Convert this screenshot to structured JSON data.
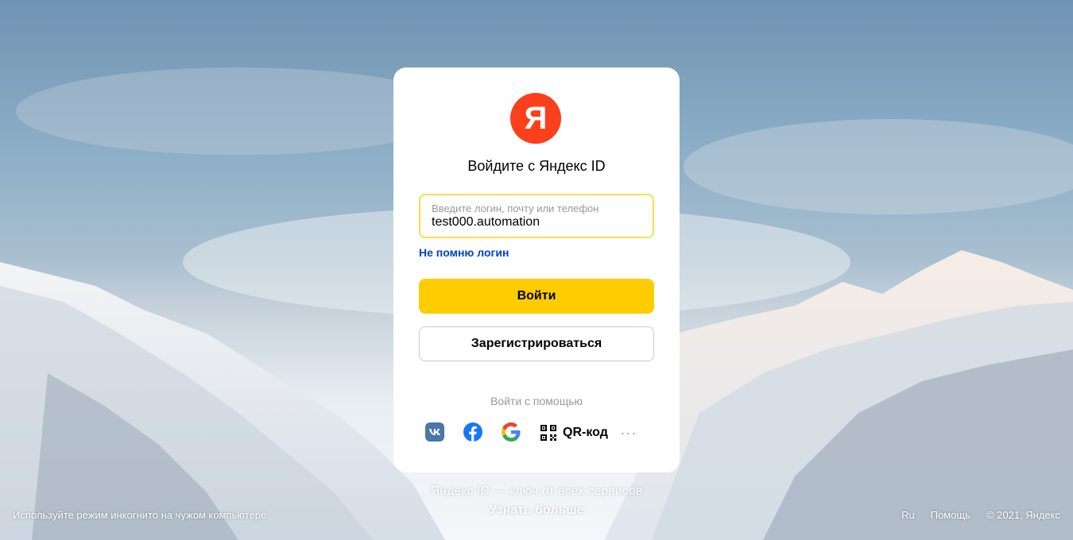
{
  "brand": {
    "logo_letter": "Я",
    "logo_color": "#fc3f1d",
    "accent_yellow": "#ffcc00",
    "link_color": "#0044bb"
  },
  "card": {
    "title": "Войдите с Яндекс ID",
    "login_field": {
      "label": "Введите логин, почту или телефон",
      "value": "test000.automation"
    },
    "forgot_link": "Не помню логин",
    "login_button": "Войти",
    "register_button": "Зарегистрироваться",
    "alt_login_label": "Войти с помощью",
    "social": [
      {
        "name": "vk",
        "icon": "vk-icon"
      },
      {
        "name": "facebook",
        "icon": "facebook-icon"
      },
      {
        "name": "google",
        "icon": "google-icon"
      },
      {
        "name": "qr",
        "icon": "qr-code-icon",
        "label": "QR-код"
      },
      {
        "name": "more",
        "icon": "more-dots-icon",
        "label": "···"
      }
    ]
  },
  "tagline": "Яндекс ID — ключ от всех сервисов",
  "learn_more": "Узнать больше",
  "footer": {
    "incognito_hint": "Используйте режим инкогнито на чужом компьютере",
    "lang": "Ru",
    "help": "Помощь",
    "copyright": "© 2021, Яндекс"
  }
}
